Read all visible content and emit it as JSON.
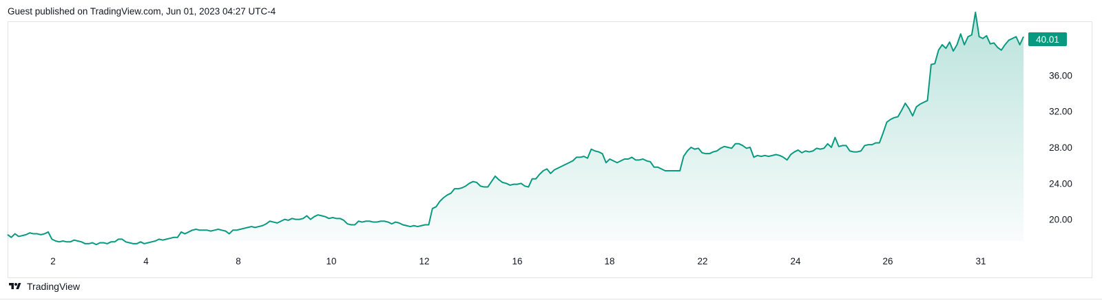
{
  "header": {
    "published": "Guest published on TradingView.com, Jun 01, 2023 04:27 UTC-4"
  },
  "footer": {
    "brand": "TradingView"
  },
  "colors": {
    "line": "#089981",
    "fill_top": "#089981",
    "badge": "#089981",
    "border": "#e0e3eb",
    "text": "#131722"
  },
  "chart_data": {
    "type": "area",
    "title": "",
    "xlabel": "",
    "ylabel": "",
    "x_ticks": [
      "2",
      "4",
      "8",
      "10",
      "12",
      "16",
      "18",
      "22",
      "24",
      "26",
      "31"
    ],
    "y_ticks": [
      20.0,
      24.0,
      28.0,
      32.0,
      36.0
    ],
    "ylim": [
      17.6,
      42.0
    ],
    "grid": false,
    "legend": "none",
    "last_price": "40.01",
    "series": [
      {
        "values": [
          18.3,
          18.0,
          18.4,
          18.1,
          18.2,
          18.3,
          18.5,
          18.4,
          18.4,
          18.3,
          18.4,
          18.6,
          17.8,
          17.6,
          17.5,
          17.6,
          17.5,
          17.5,
          17.7,
          17.6,
          17.5,
          17.3,
          17.3,
          17.4,
          17.2,
          17.4,
          17.4,
          17.3,
          17.5,
          17.5,
          17.8,
          17.8,
          17.5,
          17.4,
          17.3,
          17.3,
          17.5,
          17.3,
          17.4,
          17.5,
          17.6,
          17.8,
          17.7,
          17.8,
          17.9,
          18.0,
          18.0,
          18.6,
          18.4,
          18.6,
          18.8,
          18.9,
          18.8,
          18.8,
          18.8,
          18.7,
          18.8,
          18.9,
          18.8,
          18.7,
          18.4,
          18.8,
          18.8,
          18.9,
          19.0,
          19.1,
          19.2,
          19.1,
          19.2,
          19.3,
          19.5,
          19.8,
          19.7,
          19.6,
          19.8,
          20.0,
          19.9,
          20.1,
          20.0,
          20.0,
          20.1,
          20.4,
          20.0,
          20.3,
          20.5,
          20.4,
          20.3,
          20.1,
          20.2,
          20.1,
          20.1,
          19.9,
          19.5,
          19.4,
          19.4,
          19.8,
          19.7,
          19.8,
          19.8,
          19.7,
          19.7,
          19.8,
          19.8,
          19.7,
          19.5,
          19.7,
          19.6,
          19.4,
          19.3,
          19.2,
          19.3,
          19.2,
          19.3,
          19.4,
          19.4,
          21.2,
          21.4,
          22.0,
          22.4,
          22.7,
          22.9,
          23.4,
          23.4,
          23.5,
          23.7,
          24.0,
          24.2,
          24.1,
          23.7,
          23.6,
          23.6,
          24.2,
          24.8,
          24.4,
          24.1,
          24.0,
          23.8,
          23.9,
          23.9,
          24.0,
          23.7,
          23.6,
          24.5,
          24.5,
          25.0,
          25.4,
          25.6,
          25.1,
          25.5,
          25.7,
          25.9,
          26.1,
          26.3,
          26.5,
          26.9,
          26.9,
          27.0,
          26.8,
          27.8,
          27.6,
          27.5,
          27.3,
          26.3,
          26.7,
          26.5,
          26.3,
          26.5,
          26.7,
          26.7,
          26.9,
          26.6,
          26.6,
          26.7,
          26.5,
          26.4,
          25.8,
          25.8,
          25.6,
          25.4,
          25.4,
          25.4,
          25.4,
          25.4,
          27.0,
          27.6,
          28.0,
          27.8,
          27.9,
          27.4,
          27.3,
          27.3,
          27.5,
          27.6,
          27.9,
          28.1,
          28.0,
          27.9,
          28.4,
          28.4,
          28.2,
          27.9,
          28.0,
          26.9,
          27.1,
          27.0,
          27.1,
          27.0,
          27.1,
          27.2,
          27.1,
          26.9,
          26.6,
          27.2,
          27.5,
          27.7,
          27.4,
          27.6,
          27.5,
          27.6,
          27.9,
          27.8,
          27.9,
          28.4,
          28.0,
          29.1,
          28.1,
          28.2,
          28.2,
          27.6,
          27.5,
          27.5,
          27.6,
          28.2,
          28.3,
          28.3,
          28.5,
          28.5,
          29.6,
          30.8,
          31.1,
          31.3,
          31.4,
          32.1,
          32.9,
          32.3,
          31.5,
          32.5,
          32.8,
          33.0,
          33.2,
          37.2,
          37.3,
          38.8,
          39.4,
          39.0,
          39.7,
          38.7,
          39.4,
          40.6,
          39.4,
          40.3,
          40.5,
          43.0,
          40.3,
          40.1,
          40.4,
          39.5,
          39.6,
          39.1,
          38.8,
          39.4,
          39.9,
          40.1,
          40.3,
          39.4,
          40.3
        ]
      }
    ]
  }
}
